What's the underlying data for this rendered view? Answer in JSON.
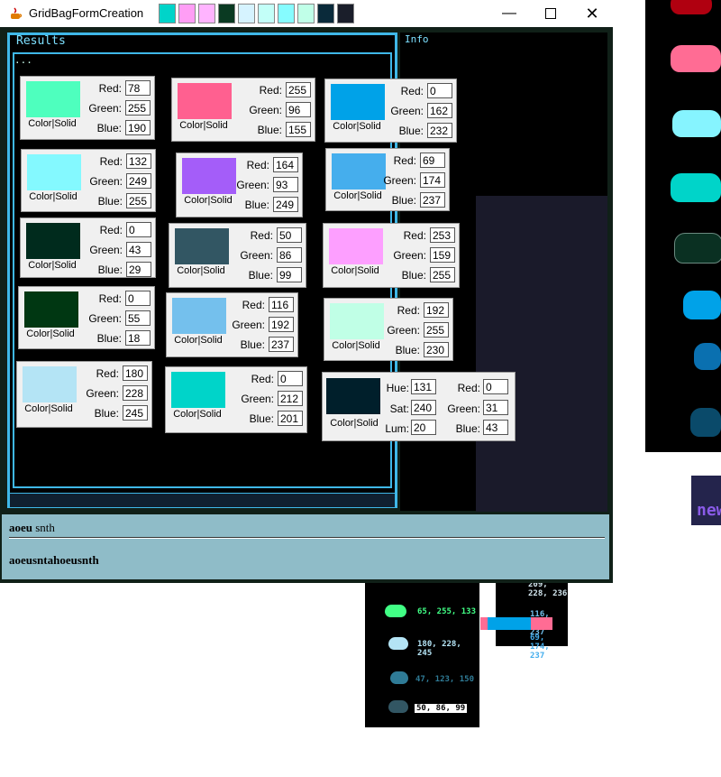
{
  "window": {
    "title": "GridBagFormCreation",
    "toolbar_swatches": [
      "#00d4c9",
      "#ff9ef5",
      "#ffb4ff",
      "#0a3a22",
      "#d6f3ff",
      "#c3fff8",
      "#86fcff",
      "#c0ffe8",
      "#0a2a3a",
      "#1a1e2a"
    ],
    "minimize_icon": "minimize-icon",
    "maximize_icon": "maximize-icon",
    "close_icon": "close-icon"
  },
  "results": {
    "label": "Results",
    "dots": "..."
  },
  "info": {
    "label": "Info"
  },
  "text_area": {
    "line1_bold": "aoeu",
    "line1_rest": " snth",
    "line2": "aoeusntahoeusnth"
  },
  "cards": [
    {
      "color": "#4effbe",
      "cs": "Color|Solid",
      "labels": [
        "Red:",
        "Green:",
        "Blue:"
      ],
      "values": [
        "78",
        "255",
        "190"
      ]
    },
    {
      "color": "#ff6090",
      "cs": "Color|Solid",
      "labels": [
        "Red:",
        "Green:",
        "Blue:"
      ],
      "values": [
        "255",
        "96",
        "155"
      ]
    },
    {
      "color": "#00a2e8",
      "cs": "Color|Solid",
      "labels": [
        "Red:",
        "Green:",
        "Blue:"
      ],
      "values": [
        "0",
        "162",
        "232"
      ]
    },
    {
      "color": "#84f9ff",
      "cs": "Color|Solid",
      "labels": [
        "Red:",
        "Green:",
        "Blue:"
      ],
      "values": [
        "132",
        "249",
        "255"
      ]
    },
    {
      "color": "#a45df9",
      "cs": "Color|Solid",
      "labels": [
        "Red:",
        "Green:",
        "Blue:"
      ],
      "values": [
        "164",
        "93",
        "249"
      ]
    },
    {
      "color": "#45aeed",
      "cs": "Color|Solid",
      "labels": [
        "Red:",
        "Green:",
        "Blue:"
      ],
      "values": [
        "69",
        "174",
        "237"
      ]
    },
    {
      "color": "#002b1d",
      "cs": "Color|Solid",
      "labels": [
        "Red:",
        "Green:",
        "Blue:"
      ],
      "values": [
        "0",
        "43",
        "29"
      ]
    },
    {
      "color": "#325663",
      "cs": "Color|Solid",
      "labels": [
        "Red:",
        "Green:",
        "Blue:"
      ],
      "values": [
        "50",
        "86",
        "99"
      ]
    },
    {
      "color": "#fd9fff",
      "cs": "Color|Solid",
      "labels": [
        "Red:",
        "Green:",
        "Blue:"
      ],
      "values": [
        "253",
        "159",
        "255"
      ]
    },
    {
      "color": "#003712",
      "cs": "Color|Solid",
      "labels": [
        "Red:",
        "Green:",
        "Blue:"
      ],
      "values": [
        "0",
        "55",
        "18"
      ]
    },
    {
      "color": "#74c0ed",
      "cs": "Color|Solid",
      "labels": [
        "Red:",
        "Green:",
        "Blue:"
      ],
      "values": [
        "116",
        "192",
        "237"
      ]
    },
    {
      "color": "#c0ffe6",
      "cs": "Color|Solid",
      "labels": [
        "Red:",
        "Green:",
        "Blue:"
      ],
      "values": [
        "192",
        "255",
        "230"
      ]
    },
    {
      "color": "#b4e4f5",
      "cs": "Color|Solid",
      "labels": [
        "Red:",
        "Green:",
        "Blue:"
      ],
      "values": [
        "180",
        "228",
        "245"
      ]
    },
    {
      "color": "#00d4c9",
      "cs": "Color|Solid",
      "labels": [
        "Red:",
        "Green:",
        "Blue:"
      ],
      "values": [
        "0",
        "212",
        "201"
      ]
    }
  ],
  "hsl_card": {
    "color": "#001f2b",
    "cs": "Color|Solid",
    "hsl_labels": [
      "Hue:",
      "Sat:",
      "Lum:"
    ],
    "hsl_values": [
      "131",
      "240",
      "20"
    ],
    "rgb_labels": [
      "Red:",
      "Green:",
      "Blue:"
    ],
    "rgb_values": [
      "0",
      "31",
      "43"
    ]
  },
  "debris": {
    "new_text": "new",
    "below_items": [
      "209, 228, 236",
      "65, 255, 133",
      "116, 192, 237",
      "69, 174, 237",
      "180, 228, 245",
      "47, 123, 150",
      "50, 86, 99"
    ]
  }
}
